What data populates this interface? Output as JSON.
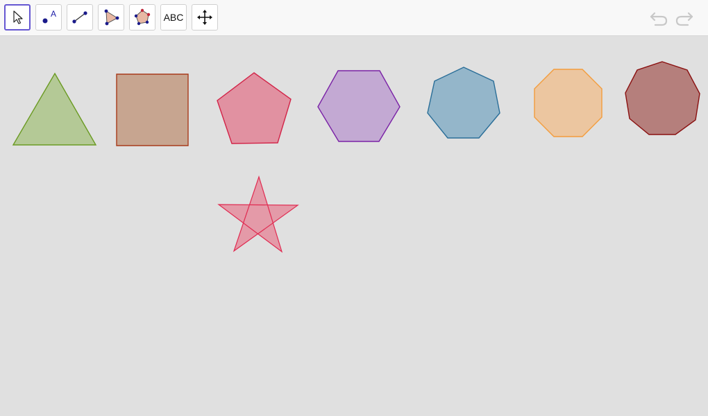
{
  "toolbar": {
    "tools": [
      {
        "name": "move-tool",
        "icon": "cursor-arrow-icon",
        "selected": true
      },
      {
        "name": "point-tool",
        "icon": "point-icon",
        "label": "A",
        "selected": false
      },
      {
        "name": "segment-tool",
        "icon": "segment-icon",
        "selected": false
      },
      {
        "name": "polygon-tool",
        "icon": "triangle-polygon-icon",
        "selected": false
      },
      {
        "name": "regular-polygon-tool",
        "icon": "regular-polygon-icon",
        "selected": false
      },
      {
        "name": "text-tool",
        "label": "ABC",
        "selected": false
      },
      {
        "name": "move-graphics-view-tool",
        "icon": "four-arrows-icon",
        "selected": false
      }
    ],
    "undo_icon": "undo-icon",
    "redo_icon": "redo-icon",
    "accent_color": "#6557d2"
  },
  "canvas": {
    "background": "#e0e0e0",
    "shapes": [
      {
        "name": "triangle",
        "sides": 3,
        "fill": "#b4c996",
        "stroke": "#6a9a22"
      },
      {
        "name": "square",
        "sides": 4,
        "fill": "#c7a590",
        "stroke": "#a83a1a"
      },
      {
        "name": "pentagon",
        "sides": 5,
        "fill": "#e191a1",
        "stroke": "#d22448"
      },
      {
        "name": "hexagon",
        "sides": 6,
        "fill": "#c3a9d3",
        "stroke": "#7a22a6"
      },
      {
        "name": "heptagon",
        "sides": 7,
        "fill": "#94b6ca",
        "stroke": "#2a6e98"
      },
      {
        "name": "octagon",
        "sides": 8,
        "fill": "#ecc6a0",
        "stroke": "#f39c3c"
      },
      {
        "name": "nonagon",
        "sides": 9,
        "fill": "#b57f7c",
        "stroke": "#8a1010"
      },
      {
        "name": "pentagram",
        "sides": 5,
        "fill": "#e49aa8",
        "stroke": "#e02a50"
      }
    ]
  }
}
